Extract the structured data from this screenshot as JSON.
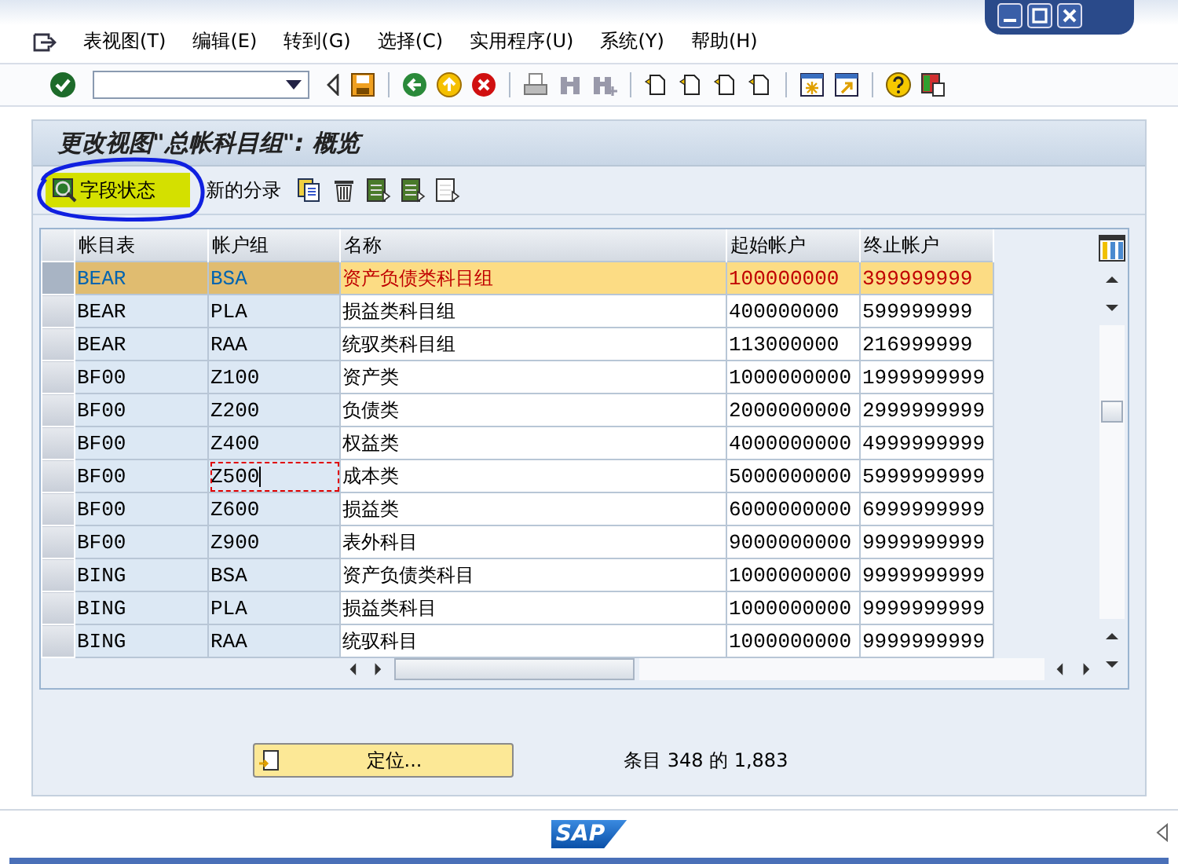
{
  "menu": [
    "表视图(T)",
    "编辑(E)",
    "转到(G)",
    "选择(C)",
    "实用程序(U)",
    "系统(Y)",
    "帮助(H)"
  ],
  "screen_title": "更改视图\"总帐科目组\": 概览",
  "app_toolbar": {
    "field_status": "字段状态",
    "new_entries": "新的分录"
  },
  "table": {
    "columns": [
      "帐目表",
      "帐户组",
      "名称",
      "起始帐户",
      "终止帐户"
    ],
    "rows": [
      {
        "selected": true,
        "focused": false,
        "cells": [
          "BEAR",
          "BSA",
          "资产负债类科目组",
          "100000000",
          "399999999"
        ]
      },
      {
        "selected": false,
        "focused": false,
        "cells": [
          "BEAR",
          "PLA",
          "损益类科目组",
          "400000000",
          "599999999"
        ]
      },
      {
        "selected": false,
        "focused": false,
        "cells": [
          "BEAR",
          "RAA",
          "统驭类科目组",
          "113000000",
          "216999999"
        ]
      },
      {
        "selected": false,
        "focused": false,
        "cells": [
          "BF00",
          "Z100",
          "资产类",
          "1000000000",
          "1999999999"
        ]
      },
      {
        "selected": false,
        "focused": false,
        "cells": [
          "BF00",
          "Z200",
          "负债类",
          "2000000000",
          "2999999999"
        ]
      },
      {
        "selected": false,
        "focused": false,
        "cells": [
          "BF00",
          "Z400",
          "权益类",
          "4000000000",
          "4999999999"
        ]
      },
      {
        "selected": false,
        "focused": true,
        "cells": [
          "BF00",
          "Z500",
          "成本类",
          "5000000000",
          "5999999999"
        ]
      },
      {
        "selected": false,
        "focused": false,
        "cells": [
          "BF00",
          "Z600",
          "损益类",
          "6000000000",
          "6999999999"
        ]
      },
      {
        "selected": false,
        "focused": false,
        "cells": [
          "BF00",
          "Z900",
          "表外科目",
          "9000000000",
          "9999999999"
        ]
      },
      {
        "selected": false,
        "focused": false,
        "cells": [
          "BING",
          "BSA",
          "资产负债类科目",
          "1000000000",
          "9999999999"
        ]
      },
      {
        "selected": false,
        "focused": false,
        "cells": [
          "BING",
          "PLA",
          "损益类科目",
          "1000000000",
          "9999999999"
        ]
      },
      {
        "selected": false,
        "focused": false,
        "cells": [
          "BING",
          "RAA",
          "统驭科目",
          "1000000000",
          "9999999999"
        ]
      }
    ]
  },
  "position_button": "定位...",
  "entry_info": "条目 348 的 1,883",
  "logo": "SAP"
}
